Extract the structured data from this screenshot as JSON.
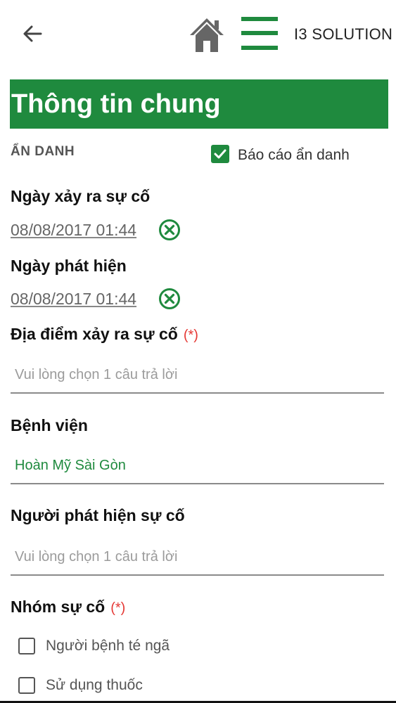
{
  "appbar": {
    "brand": "I3 SOLUTION"
  },
  "banner": {
    "title": "Thông tin chung"
  },
  "anonymous": {
    "section_label": "ẨN DANH",
    "checkbox_label": "Báo cáo ẩn danh",
    "checked": true
  },
  "incident_date": {
    "label": "Ngày xảy ra sự cố",
    "value": "08/08/2017 01:44"
  },
  "detected_date": {
    "label": "Ngày phát hiện",
    "value": "08/08/2017 01:44"
  },
  "location": {
    "label": "Địa điểm xảy ra sự cố",
    "required": "(*)",
    "placeholder": "Vui lòng chọn 1 câu trả lời"
  },
  "hospital": {
    "label": "Bệnh viện",
    "value": "Hoàn Mỹ Sài Gòn"
  },
  "detector": {
    "label": "Người phát hiện sự cố",
    "placeholder": "Vui lòng chọn 1 câu trả lời"
  },
  "group": {
    "label": "Nhóm sự cố",
    "required": "(*)",
    "options": [
      {
        "label": "Người bệnh té ngã",
        "checked": false
      },
      {
        "label": "Sử dụng thuốc",
        "checked": false
      }
    ]
  },
  "colors": {
    "accent": "#1f8a3e",
    "required": "#e53935"
  }
}
